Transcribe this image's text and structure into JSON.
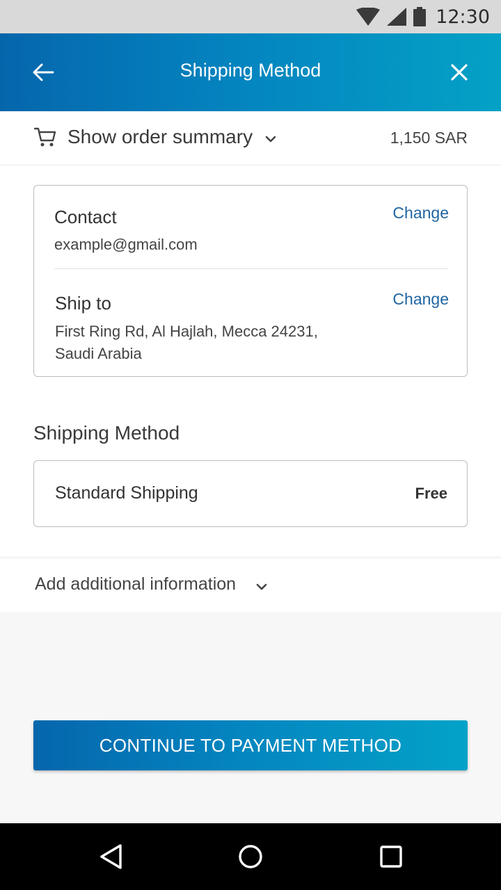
{
  "status_bar": {
    "time": "12:30",
    "icons": [
      "wifi-icon",
      "signal-icon",
      "battery-icon"
    ]
  },
  "app_bar": {
    "title": "Shipping Method",
    "back_icon": "arrow-left-icon",
    "close_icon": "close-icon",
    "colors": {
      "gradient_start": "#0566ac",
      "gradient_end": "#04a1c6"
    }
  },
  "order_summary": {
    "label": "Show order summary",
    "total": "1,150 SAR",
    "icon": "cart-icon"
  },
  "info_card": {
    "contact": {
      "title": "Contact",
      "value": "example@gmail.com",
      "change_label": "Change"
    },
    "ship_to": {
      "title": "Ship to",
      "value": "First Ring Rd, Al Hajlah, Mecca 24231, Saudi Arabia",
      "change_label": "Change"
    },
    "link_color": "#1f65a2"
  },
  "shipping": {
    "heading": "Shipping Method",
    "option": {
      "name": "Standard Shipping",
      "price": "Free"
    }
  },
  "additional_info": {
    "label": "Add additional information"
  },
  "footer": {
    "continue_label": "CONTINUE TO PAYMENT METHOD"
  },
  "nav_bar": {
    "icons": [
      "back-triangle-icon",
      "home-circle-icon",
      "recents-square-icon"
    ]
  }
}
